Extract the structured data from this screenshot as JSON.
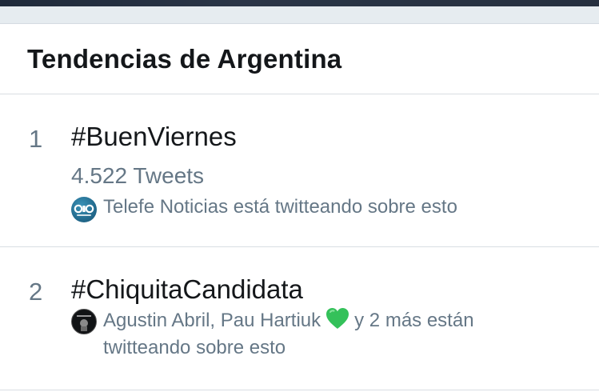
{
  "header": {
    "title": "Tendencias de Argentina"
  },
  "trends": [
    {
      "rank": "1",
      "hashtag": "#BuenViernes",
      "tweet_count": "4.522 Tweets",
      "context": "Telefe Noticias está twitteando sobre esto",
      "avatar_icon": "telefe-noticias-logo"
    },
    {
      "rank": "2",
      "hashtag": "#ChiquitaCandidata",
      "context_prefix": "Agustin Abril, Pau Hartiuk",
      "context_emoji": "green-heart-emoji",
      "context_suffix": "y 2 más están",
      "context_line2": "twitteando sobre esto",
      "avatar_icon": "agustin-abril-avatar"
    }
  ],
  "colors": {
    "primary_text": "#14171a",
    "secondary_text": "#657786",
    "divider": "#d8dee3",
    "band": "#e6ecf0",
    "heart": "#2ecc71"
  }
}
